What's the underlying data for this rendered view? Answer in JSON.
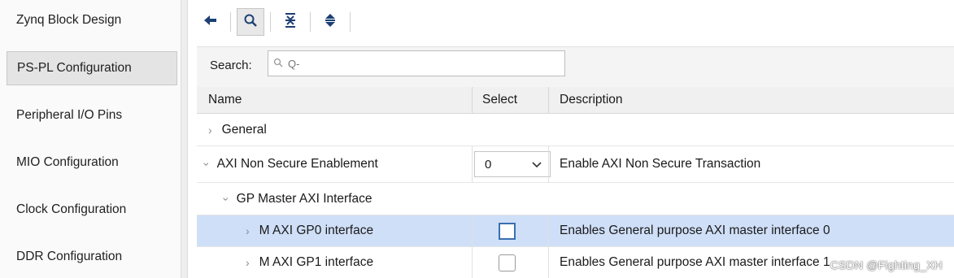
{
  "sidebar": {
    "items": [
      {
        "label": "Zynq Block Design"
      },
      {
        "label": "PS-PL Configuration"
      },
      {
        "label": "Peripheral I/O Pins"
      },
      {
        "label": "MIO Configuration"
      },
      {
        "label": "Clock Configuration"
      },
      {
        "label": "DDR Configuration"
      }
    ],
    "active_index": 1
  },
  "toolbar": {
    "icons": [
      "back-arrow-icon",
      "search-icon",
      "collapse-all-icon",
      "expand-all-icon"
    ]
  },
  "search": {
    "label": "Search:",
    "placeholder": "Q-",
    "value": ""
  },
  "table": {
    "columns": {
      "name": "Name",
      "select": "Select",
      "description": "Description"
    },
    "rows": [
      {
        "name": "General",
        "description": ""
      },
      {
        "name": "AXI Non Secure Enablement",
        "select_value": "0",
        "description": "Enable AXI Non Secure Transaction"
      },
      {
        "name": "GP Master AXI Interface",
        "description": ""
      },
      {
        "name": "M AXI GP0 interface",
        "checked": false,
        "description": "Enables General purpose AXI master interface 0"
      },
      {
        "name": "M AXI GP1 interface",
        "checked": false,
        "description": "Enables General purpose AXI master interface 1"
      }
    ]
  },
  "watermark": "CSDN @Fighting_XH",
  "colors": {
    "selected_row": "#cfdff8",
    "focus_border": "#3a6fb0"
  }
}
